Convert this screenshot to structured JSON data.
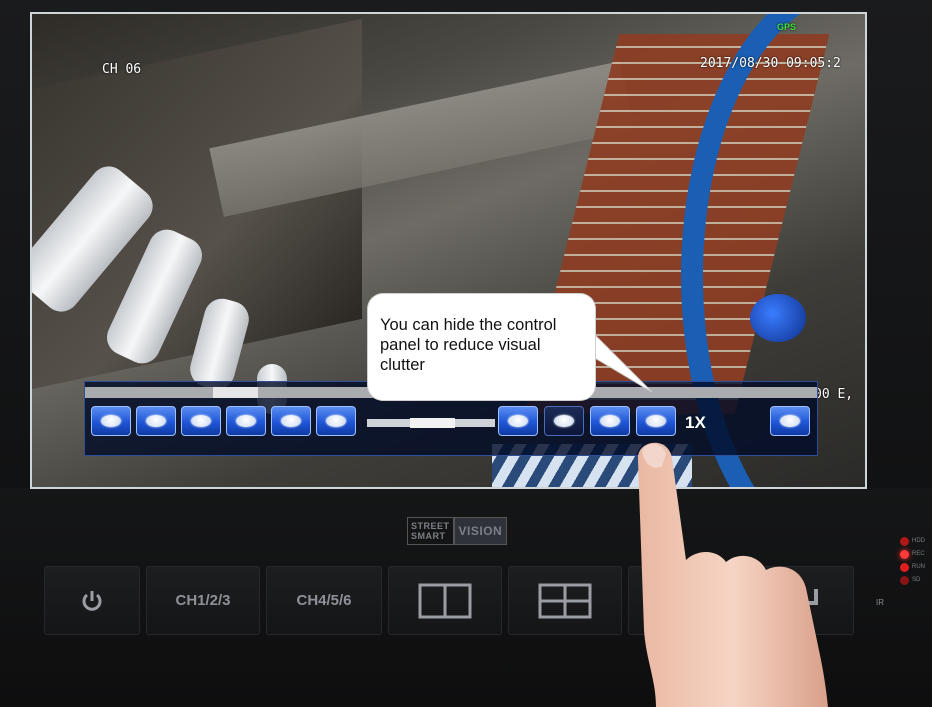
{
  "osd": {
    "channel": "CH 06",
    "datetime": "2017/08/30 09:05:2",
    "gps": "GPS",
    "speed_partial": "00 E,"
  },
  "control_panel": {
    "playback_buttons": [
      {
        "icon": "playback-button-icon"
      },
      {
        "icon": "playback-button-icon"
      },
      {
        "icon": "playback-button-icon"
      },
      {
        "icon": "playback-button-icon"
      },
      {
        "icon": "playback-button-icon"
      },
      {
        "icon": "playback-button-icon"
      },
      {
        "icon": "playback-button-icon"
      },
      {
        "icon": "playback-button-icon"
      },
      {
        "icon": "playback-button-icon"
      },
      {
        "icon": "playback-button-icon"
      }
    ],
    "speed_label": "1X"
  },
  "callout": {
    "text": "You can hide the control panel to reduce visual clutter"
  },
  "device": {
    "brand_line1": "STREET",
    "brand_line2": "SMART",
    "brand_line3": "VISION",
    "buttons": [
      {
        "label": "",
        "icon": "power-icon"
      },
      {
        "label": "CH1/2/3"
      },
      {
        "label": "CH4/5/6"
      },
      {
        "label": "",
        "icon": "split-2-icon"
      },
      {
        "label": "",
        "icon": "split-4-icon"
      },
      {
        "label": "",
        "icon": "menu-icon"
      },
      {
        "label": "",
        "icon": "enter-icon"
      }
    ],
    "leds": [
      {
        "label": "HDD",
        "color": "#b01818"
      },
      {
        "label": "REC",
        "color": "#ff2a2a"
      },
      {
        "label": "RUN",
        "color": "#e01e1e"
      },
      {
        "label": "SD",
        "color": "#8a1414"
      }
    ],
    "ir_label": "IR"
  }
}
